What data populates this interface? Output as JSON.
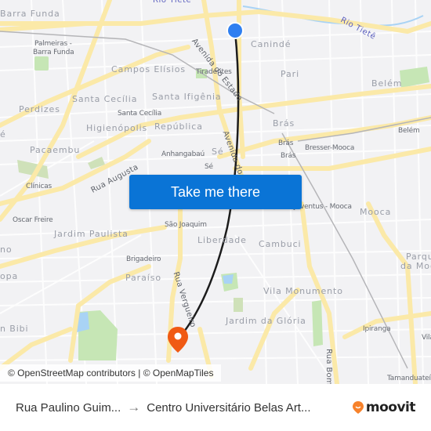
{
  "map": {
    "labels": {
      "rio_tiete_top": "Rio Tietê",
      "rio_tiete_right": "Rio Tietê",
      "barra_funda": "Barra Funda",
      "palmeiras_barra_funda_1": "Palmeiras -",
      "palmeiras_barra_funda_2": "Barra Funda",
      "campos_eliseos": "Campos Elísios",
      "tiradentes": "Tiradentes",
      "caninde": "Canindé",
      "pari": "Pari",
      "belem_district": "Belém",
      "belem_station": "Belém",
      "santa_cecilia_district": "Santa Cecília",
      "santa_cecilia_station": "Santa Cecília",
      "santa_ifigenia": "Santa Ifigênia",
      "perdizes": "Perdizes",
      "higienopolis": "Higienópolis",
      "republica": "República",
      "bras_district": "Brás",
      "bras_station_1": "Brás",
      "bras_station_2": "Brás",
      "bresser_mooca": "Bresser-Mooca",
      "pacaembu": "Pacaembu",
      "anhangabau": "Anhangabaú",
      "se_district": "Sé",
      "se_station": "Sé",
      "rua_augusta": "Rua Augusta",
      "clinicas": "Clínicas",
      "oscar_freire": "Oscar Freire",
      "jardim_paulista": "Jardim Paulista",
      "sao_joaquim": "São Joaquim",
      "liberdade": "Liberdade",
      "cambuci": "Cambuci",
      "juventus_mooca": "Juventus - Mooca",
      "mooca": "Mooca",
      "parque_da_mooca_1": "Parque",
      "parque_da_mooca_2": "da Mooca",
      "brigadeiro": "Brigadeiro",
      "paraiso": "Paraíso",
      "rua_vergueiro": "Rua Vergueiro",
      "vila_monumento": "Vila Monumento",
      "jardim_da_gloria": "Jardim da Glória",
      "ipiranga": "Ipiranga",
      "vila": "Vila",
      "rua_bom": "Rua Bom",
      "tamanduatei": "Tamanduateí",
      "jardim_bibi": "n Bibi",
      "europa": "opa",
      "avenida_do_estado_top": "Avenida do Estado",
      "avenida_do_estado_mid": "Avenida do",
      "left_edge_1": "é",
      "left_edge_2": "no"
    },
    "attribution": "© OpenStreetMap contributors | © OpenMapTiles",
    "colors": {
      "origin_marker": "#2f7ff0",
      "destination_marker": "#f05a14",
      "route_line": "#1c1c1c",
      "road": "#fbe9a8",
      "park": "#c6e6b5",
      "water": "#a9d3f5"
    }
  },
  "cta": {
    "label": "Take me there"
  },
  "footer": {
    "origin": "Rua Paulino Guim...",
    "arrow": "→",
    "destination": "Centro Universitário Belas Art...",
    "brand": "moovit"
  }
}
